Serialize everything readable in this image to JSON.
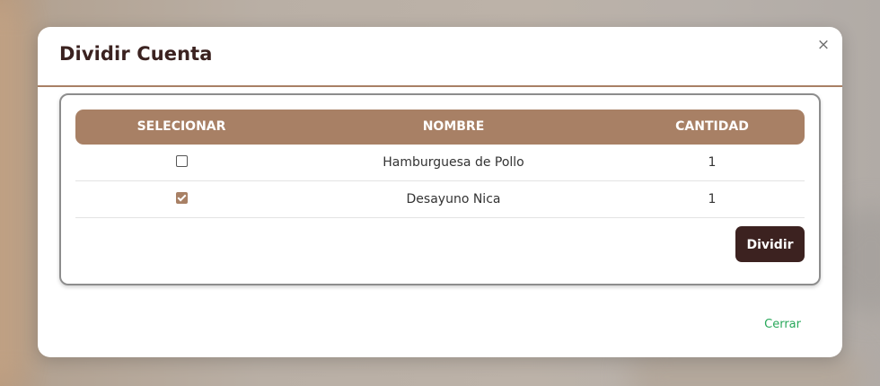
{
  "modal": {
    "title": "Dividir Cuenta",
    "close_symbol": "×",
    "close_icon": "close-icon"
  },
  "table": {
    "headers": [
      "SELECIONAR",
      "NOMBRE",
      "CANTIDAD"
    ],
    "rows": [
      {
        "selected": false,
        "name": "Hamburguesa de Pollo",
        "quantity": "1"
      },
      {
        "selected": true,
        "name": "Desayuno Nica",
        "quantity": "1"
      }
    ]
  },
  "actions": {
    "divide_label": "Dividir",
    "close_label": "Cerrar"
  },
  "colors": {
    "header_bg": "#a88065",
    "title": "#3b2220",
    "primary_button": "#3c2220",
    "link": "#28a85a"
  }
}
